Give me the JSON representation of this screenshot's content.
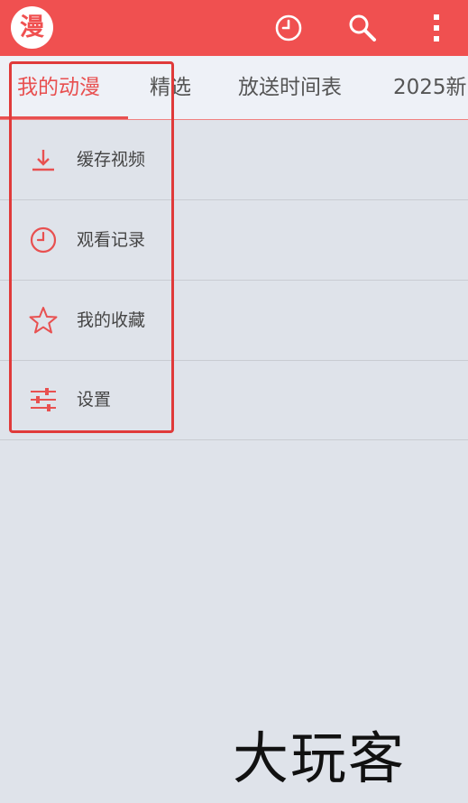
{
  "app_bar": {
    "logo_text": "漫",
    "icons": [
      "clock-icon",
      "search-icon",
      "more-vert-icon"
    ],
    "color": "#f05050"
  },
  "tabs": [
    {
      "label": "我的动漫",
      "active": true
    },
    {
      "label": "精选",
      "active": false
    },
    {
      "label": "放送时间表",
      "active": false
    },
    {
      "label": "2025新",
      "active": false
    }
  ],
  "menu": {
    "items": [
      {
        "label": "缓存视频",
        "icon": "download-icon"
      },
      {
        "label": "观看记录",
        "icon": "history-clock-icon"
      },
      {
        "label": "我的收藏",
        "icon": "star-icon"
      },
      {
        "label": "设置",
        "icon": "settings-sliders-icon"
      }
    ]
  },
  "watermark": "大玩客",
  "accent_color": "#e85050"
}
